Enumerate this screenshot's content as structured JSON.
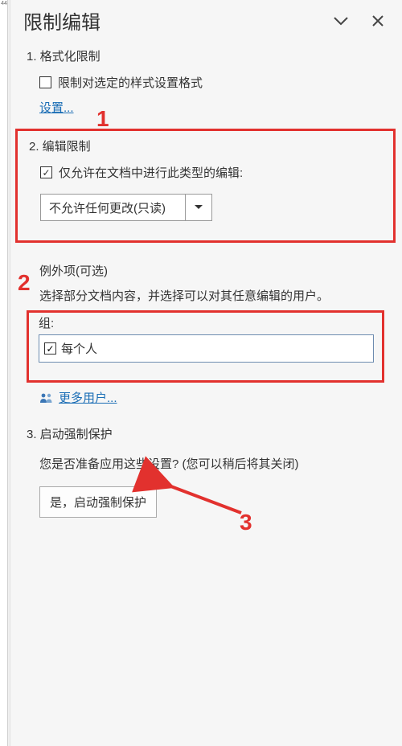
{
  "ruler": {
    "tick": "44"
  },
  "panel": {
    "title": "限制编辑",
    "section1": {
      "heading": "1. 格式化限制",
      "checkbox_label": "限制对选定的样式设置格式",
      "settings_link": "设置..."
    },
    "section2": {
      "heading": "2. 编辑限制",
      "checkbox_label": "仅允许在文档中进行此类型的编辑:",
      "dropdown_value": "不允许任何更改(只读)",
      "exceptions_heading": "例外项(可选)",
      "exceptions_desc": "选择部分文档内容，并选择可以对其任意编辑的用户。",
      "group_label": "组:",
      "group_item": "每个人",
      "more_users_link": "更多用户..."
    },
    "section3": {
      "heading": "3. 启动强制保护",
      "desc": "您是否准备应用这些设置? (您可以稍后将其关闭)",
      "button": "是，启动强制保护"
    }
  },
  "annotations": {
    "n1": "1",
    "n2": "2",
    "n3": "3"
  }
}
